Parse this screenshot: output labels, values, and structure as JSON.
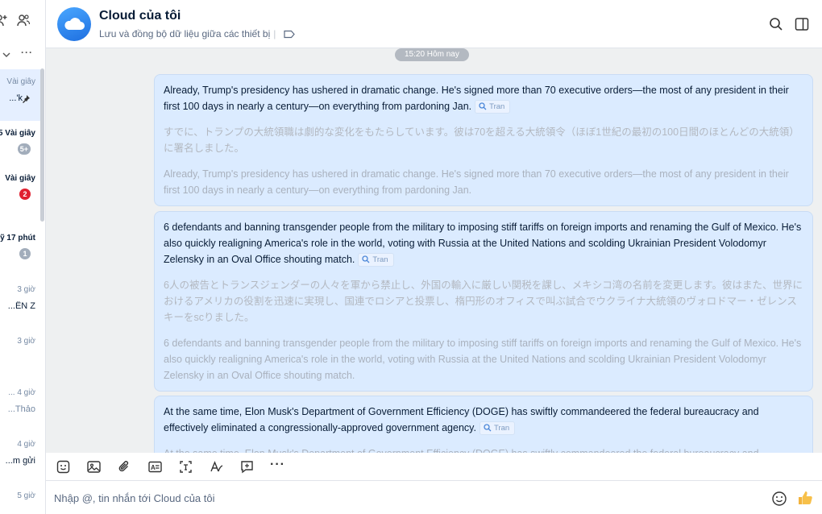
{
  "sidebar": {
    "items": [
      {
        "time": "Vài giây",
        "snippet": "k'...",
        "pinned": true,
        "active": true,
        "bold": false
      },
      {
        "time": "5 Vài giây",
        "badge": "5+",
        "badge_color": "grey",
        "bold": true
      },
      {
        "time": "Vài giây",
        "badge": "2",
        "badge_color": "red",
        "bold": true
      },
      {
        "time": "ỹ 17 phút",
        "badge": "1",
        "badge_color": "grey",
        "bold": true
      },
      {
        "time": "3 giờ",
        "snippet": "ÊN Z...",
        "bold": false
      },
      {
        "time": "3 giờ",
        "snippet": "",
        "bold": false
      },
      {
        "time": "... 4 giờ",
        "snippet": "Thảo...",
        "bold": false
      },
      {
        "time": "4 giờ",
        "snippet": "m gửi...",
        "bold": false
      },
      {
        "time": "5 giờ",
        "snippet": "",
        "bold": false
      }
    ]
  },
  "header": {
    "title": "Cloud của tôi",
    "subtitle": "Lưu và đồng bộ dữ liệu giữa các thiết bị"
  },
  "chat": {
    "date_divider": "15:20 Hôm nay",
    "translate_label": "Tran",
    "messages": [
      {
        "text": "Already, Trump's presidency has ushered in dramatic change. He's signed more than 70 executive orders—the most of any president in their first 100 days in nearly a century—on everything from pardoning Jan.",
        "ja": "すでに、トランプの大統領職は劇的な変化をもたらしています。彼は70を超える大統領令（ほぼ1世紀の最初の100日間のほとんどの大統領）に署名しました。",
        "echo": "Already, Trump's presidency has ushered in dramatic change. He's signed more than 70 executive orders—the most of any president in their first 100 days in nearly a century—on everything from pardoning Jan."
      },
      {
        "text": "6 defendants and banning transgender people from the military to imposing stiff tariffs on foreign imports and renaming the Gulf of Mexico. He's also quickly realigning America's role in the world, voting with Russia at the United Nations and scolding Ukrainian President Volodomyr Zelensky in an Oval Office shouting match.",
        "ja": "6人の被告とトランスジェンダーの人々を軍から禁止し、外国の輸入に厳しい関税を課し、メキシコ湾の名前を変更します。彼はまた、世界におけるアメリカの役割を迅速に実現し、国連でロシアと投票し、楕円形のオフィスで叫ぶ試合でウクライナ大統領のヴォロドマー・ゼレンスキーをscりました。",
        "echo": "6 defendants and banning transgender people from the military to imposing stiff tariffs on foreign imports and renaming the Gulf of Mexico. He's also quickly realigning America's role in the world, voting with Russia at the United Nations and scolding Ukrainian President Volodomyr Zelensky in an Oval Office shouting match."
      },
      {
        "text": "At the same time, Elon Musk's Department of Government Efficiency (DOGE) has swiftly commandeered the federal bureaucracy and effectively eliminated a congressionally-approved government agency.",
        "echo": "At the same time, Elon Musk's Department of Government Efficiency (DOGE) has swiftly commandeered the federal bureaucracy and effectively"
      }
    ]
  },
  "composer": {
    "placeholder": "Nhập @, tin nhắn tới Cloud của tôi"
  },
  "colors": {
    "bubble": "#dbebff",
    "accent": "#0068ff",
    "chat_bg": "#eef0f1"
  }
}
